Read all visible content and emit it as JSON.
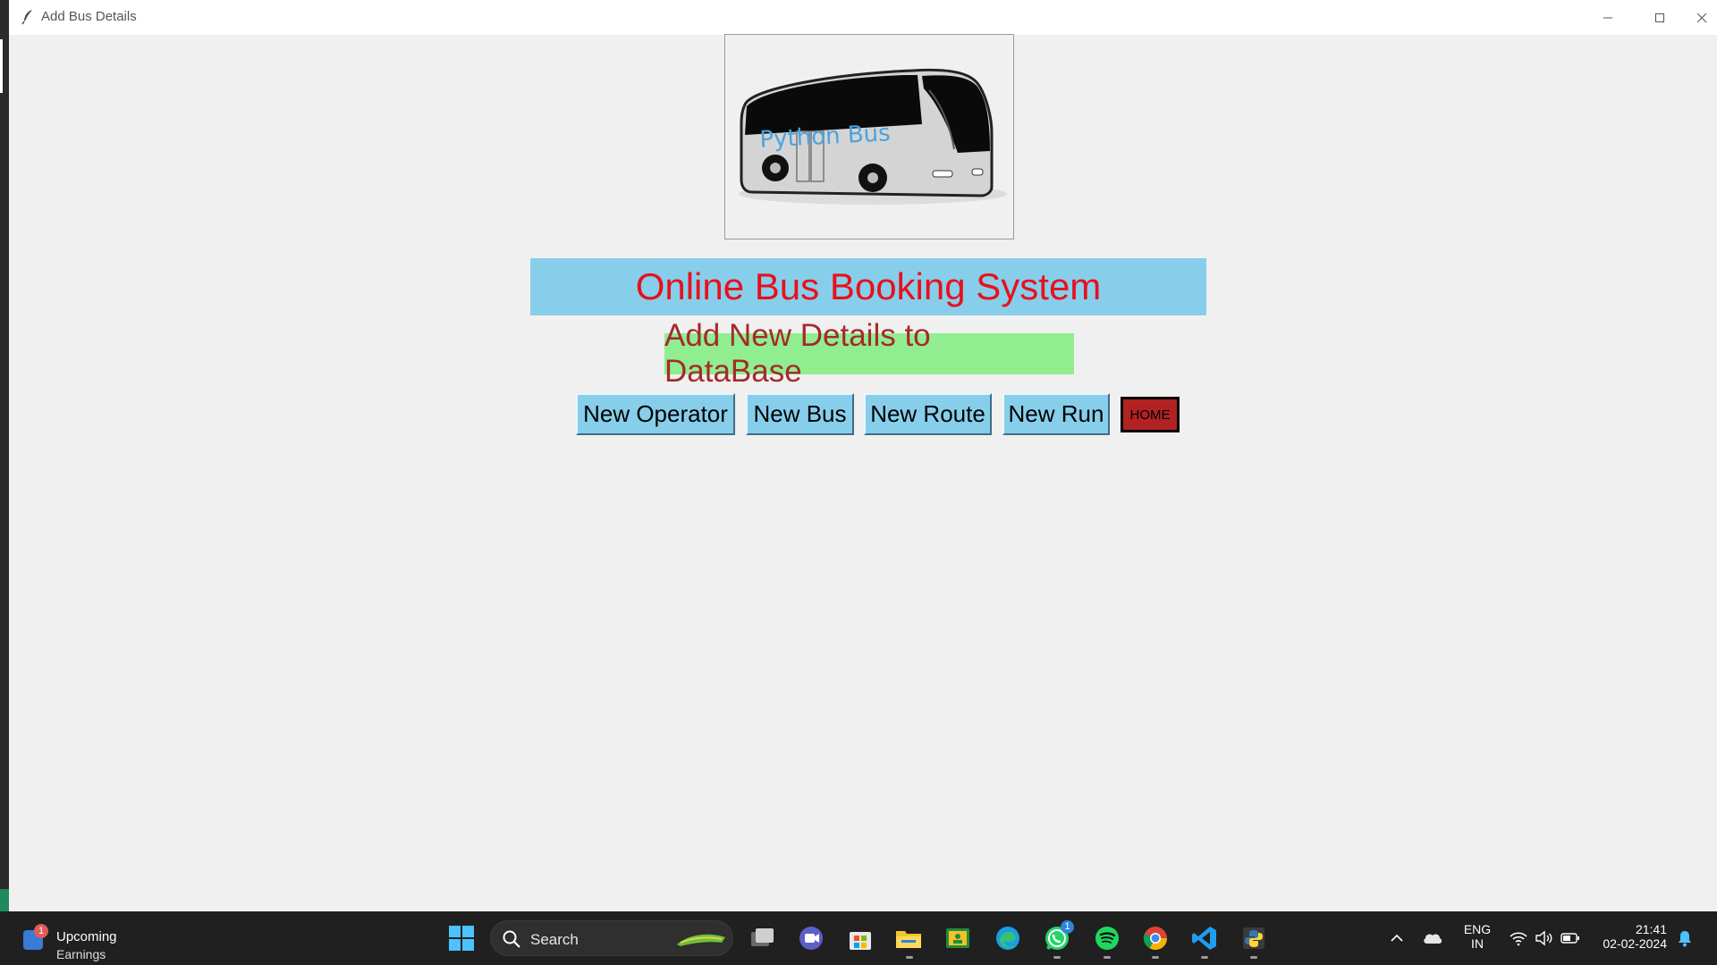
{
  "window": {
    "title": "Add Bus Details",
    "controls": {
      "minimize": "—",
      "maximize": "☐",
      "close": "✕"
    }
  },
  "logo": {
    "text": "Python Bus"
  },
  "header": {
    "banner": "Online Bus Booking System",
    "subtitle": "Add New Details to DataBase"
  },
  "buttons": {
    "new_operator": "New Operator",
    "new_bus": "New Bus",
    "new_route": "New Route",
    "new_run": "New Run",
    "home": "HOME"
  },
  "colors": {
    "banner_bg": "#87ceeb",
    "banner_text": "#e8101c",
    "subtitle_bg": "#90ee90",
    "subtitle_text": "#a52a2a",
    "button_bg": "#87ceeb",
    "home_bg": "#b22222"
  },
  "taskbar": {
    "widget": {
      "badge": "1",
      "title": "Upcoming",
      "subtitle": "Earnings"
    },
    "search": {
      "placeholder": "Search"
    },
    "apps": [
      "windows-start-icon",
      "search-icon",
      "task-view-icon",
      "teams-chat-icon",
      "microsoft-store-icon",
      "file-explorer-icon",
      "classroom-icon",
      "edge-icon",
      "whatsapp-icon",
      "spotify-icon",
      "chrome-icon",
      "vscode-icon",
      "python-icon"
    ],
    "whatsapp_badge": "1",
    "tray": {
      "language_top": "ENG",
      "language_bottom": "IN",
      "time": "21:41",
      "date": "02-02-2024"
    }
  }
}
